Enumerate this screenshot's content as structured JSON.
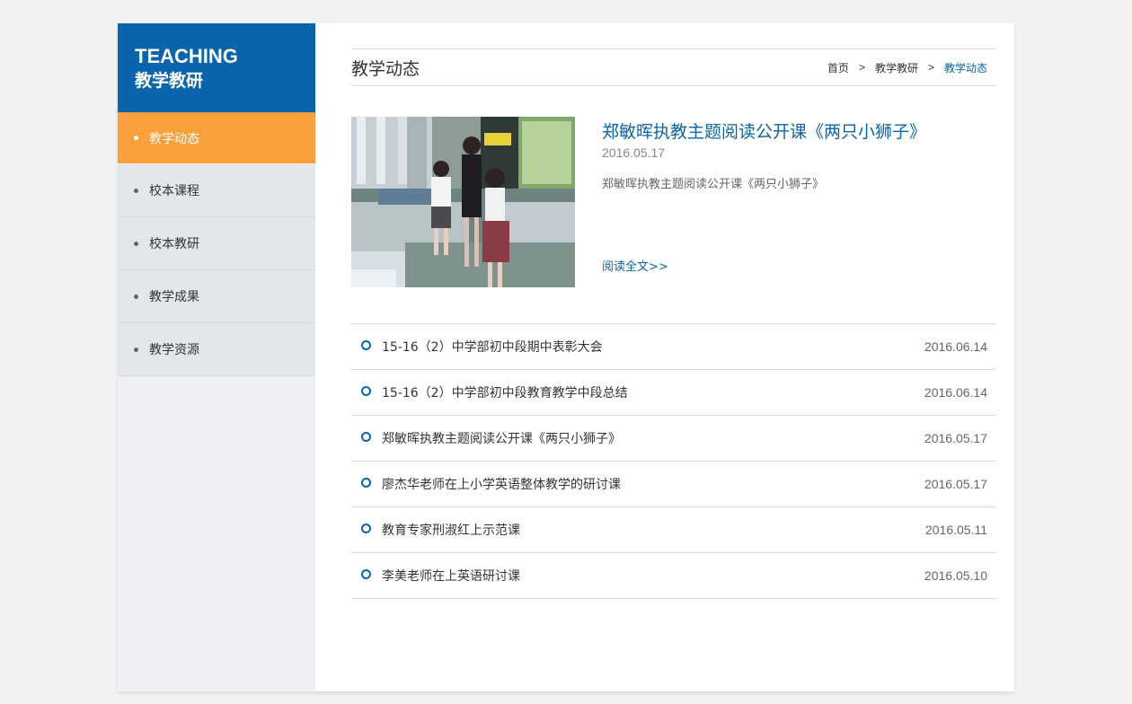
{
  "sidebar": {
    "title_en": "TEACHING",
    "title_cn": "教学教研",
    "items": [
      {
        "label": "教学动态",
        "active": true
      },
      {
        "label": "校本课程",
        "active": false
      },
      {
        "label": "校本教研",
        "active": false
      },
      {
        "label": "教学成果",
        "active": false
      },
      {
        "label": "教学资源",
        "active": false
      }
    ]
  },
  "header": {
    "title": "教学动态",
    "breadcrumb": [
      "首页",
      "教学教研",
      "教学动态"
    ],
    "separator": ">"
  },
  "feature": {
    "title": "郑敏晖执教主题阅读公开课《两只小狮子》",
    "date": "2016.05.17",
    "summary": "郑敏晖执教主题阅读公开课《两只小狮子》",
    "read_more": "阅读全文>>"
  },
  "news": [
    {
      "title": "15-16（2）中学部初中段期中表彰大会",
      "date": "2016.06.14"
    },
    {
      "title": "15-16（2）中学部初中段教育教学中段总结",
      "date": "2016.06.14"
    },
    {
      "title": "郑敏晖执教主题阅读公开课《两只小狮子》",
      "date": "2016.05.17"
    },
    {
      "title": "廖杰华老师在上小学英语整体教学的研讨课",
      "date": "2016.05.17"
    },
    {
      "title": "教育专家刑淑红上示范课",
      "date": "2016.05.11"
    },
    {
      "title": "李美老师在上英语研讨课",
      "date": "2016.05.10"
    }
  ],
  "colors": {
    "brand_blue": "#0a64ad",
    "active_orange": "#fba03a",
    "sidebar_bg": "#e3e7ea"
  }
}
